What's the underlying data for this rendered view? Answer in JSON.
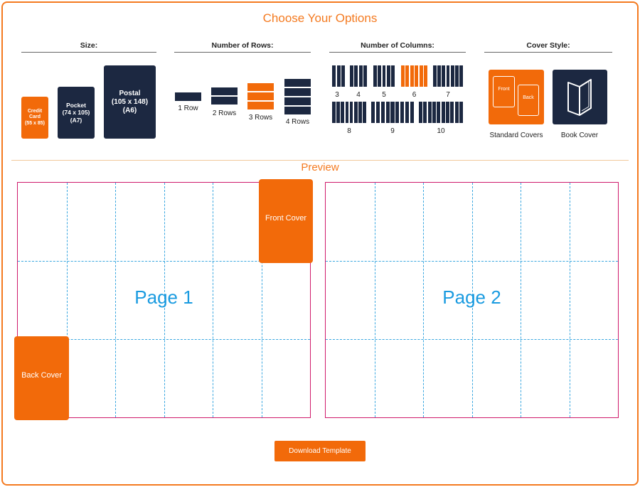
{
  "title": "Choose Your Options",
  "sections": {
    "size": "Size:",
    "rows": "Number of Rows:",
    "columns": "Number of Columns:",
    "cover": "Cover Style:"
  },
  "sizes": [
    {
      "label": "Credit\nCard\n(55 x 85)",
      "selected": true
    },
    {
      "label": "Pocket\n(74 x 105)\n(A7)",
      "selected": false
    },
    {
      "label": "Postal\n(105 x 148)\n(A6)",
      "selected": false
    }
  ],
  "rows": [
    {
      "label": "1 Row",
      "count": 1,
      "selected": false
    },
    {
      "label": "2 Rows",
      "count": 2,
      "selected": false
    },
    {
      "label": "3 Rows",
      "count": 3,
      "selected": true
    },
    {
      "label": "4 Rows",
      "count": 4,
      "selected": false
    }
  ],
  "columns": [
    {
      "label": "3",
      "count": 3,
      "selected": false
    },
    {
      "label": "4",
      "count": 4,
      "selected": false
    },
    {
      "label": "5",
      "count": 5,
      "selected": false
    },
    {
      "label": "6",
      "count": 6,
      "selected": true
    },
    {
      "label": "7",
      "count": 7,
      "selected": false
    },
    {
      "label": "8",
      "count": 8,
      "selected": false
    },
    {
      "label": "9",
      "count": 9,
      "selected": false
    },
    {
      "label": "10",
      "count": 10,
      "selected": false
    }
  ],
  "covers": [
    {
      "label": "Standard Covers",
      "front": "Front",
      "back": "Back",
      "selected": true
    },
    {
      "label": "Book Cover",
      "icon": "book-icon",
      "selected": false
    }
  ],
  "preview": {
    "title": "Preview",
    "page1": "Page 1",
    "page2": "Page 2",
    "front_cover": "Front Cover",
    "back_cover": "Back Cover"
  },
  "download_label": "Download Template",
  "colors": {
    "accent": "#f26a0a",
    "dark": "#1c2841",
    "page_border": "#cf1a6b",
    "grid": "#3aa7e0"
  }
}
